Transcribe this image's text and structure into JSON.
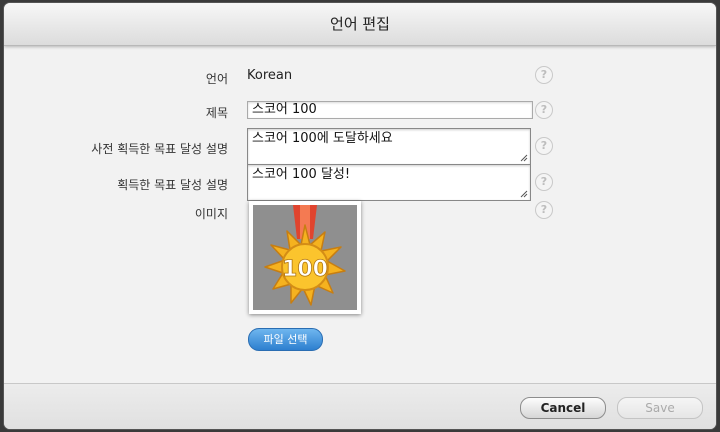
{
  "dialog": {
    "title": "언어 편집"
  },
  "form": {
    "language": {
      "label": "언어",
      "value": "Korean"
    },
    "title": {
      "label": "제목",
      "value": "스코어 100"
    },
    "pre_description": {
      "label": "사전 획득한 목표 달성 설명",
      "value": "스코어 100에 도달하세요"
    },
    "post_description": {
      "label": "획득한 목표 달성 설명",
      "value": "스코어 100 달성!"
    },
    "image": {
      "label": "이미지",
      "badge_text": "100"
    },
    "help_glyph": "?"
  },
  "buttons": {
    "choose_file": "파일 선택",
    "cancel": "Cancel",
    "save": "Save"
  },
  "colors": {
    "accent": "#2d7fcf",
    "medal_gold": "#f5b21f",
    "ribbon": "#e0442e"
  },
  "icons": [
    "help-icon",
    "medal-icon",
    "resize-grip-icon"
  ]
}
